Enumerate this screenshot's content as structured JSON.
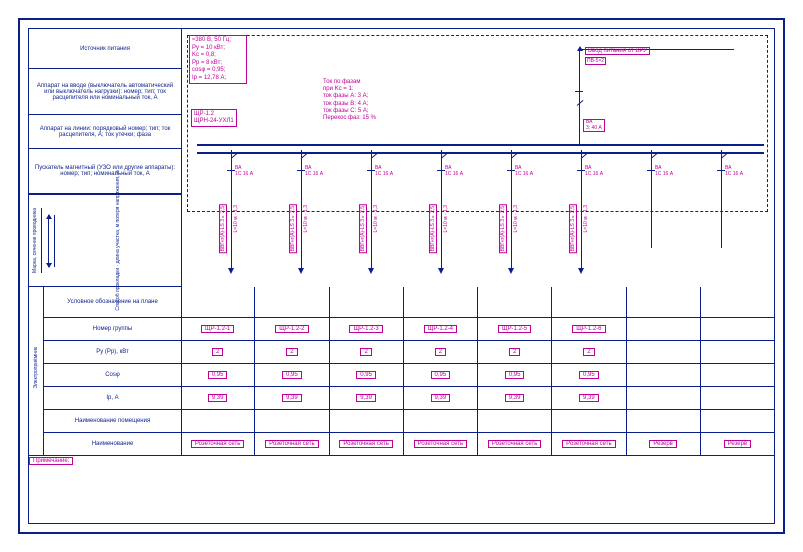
{
  "legend": {
    "row1": "Источник питания",
    "row2": "Аппарат на вводе\n(выключатель автоматический или выключатель нагрузки):\nномер; тип; ток расцепителя или номинальный ток, А",
    "row3": "Аппарат на линии:\nпорядковый номер; тип; ток расцепителя, А; ток утечки; фаза",
    "row4": "Пускатель магнитный\n(УЗО или другие аппараты):\nномер; тип; номинальный ток, А",
    "cable_side_a": "Марка, сечение проводника",
    "cable_side_b": "",
    "cable_side_c": "Способ прокладки · длина участка, м\nпотеря напряжения, %"
  },
  "lowerleft": {
    "side": "Электроприёмник",
    "rows": [
      "Условное обозначение\nна плане",
      "Номер группы",
      "Ру (Рр), кВт",
      "Cosφ",
      "Iр, А",
      "Наименование помещения",
      "Наименование"
    ]
  },
  "panel": {
    "name": "ЩР-1.2",
    "model": "ЩРН-24-УХЛ1"
  },
  "params": {
    "l1": "≈380 В, 50 Гц;",
    "l2": "Ру = 10 кВт;",
    "l3": "Kc = 0,8;",
    "l4": "Рр = 8 кВт;",
    "l5": "cosφ = 0,95;",
    "l6": "Iр = 12,78 А;"
  },
  "phases": {
    "l1": "Ток по фазам",
    "l2": "при Kc = 1:",
    "l3": "ток фазы A: 3 А;",
    "l4": "ток фазы B: 4 А;",
    "l5": "ток фазы C: 5 А;",
    "l6": "Перекос фаз: 15 %"
  },
  "input": {
    "from": "Ввод питания от ВРУ",
    "cable": "ПВ-5×2",
    "breaker_type": "ВА",
    "breaker_rating": "3; 40 А"
  },
  "feeders": [
    {
      "breaker": "ВА",
      "rating": "1С 16 А",
      "cable": "ВВГнг(А)-LS 3×2,5",
      "len": "L=10 м · 1,3",
      "group": "ЩР-1.2-1",
      "p": "2",
      "cos": "0,95",
      "i": "9,39",
      "dest": "Розеточная сеть"
    },
    {
      "breaker": "ВА",
      "rating": "1С 16 А",
      "cable": "ВВГнг(А)-LS 3×2,5",
      "len": "L=10 м · 1,3",
      "group": "ЩР-1.2-2",
      "p": "2",
      "cos": "0,95",
      "i": "9,39",
      "dest": "Розеточная сеть"
    },
    {
      "breaker": "ВА",
      "rating": "1С 16 А",
      "cable": "ВВГнг(А)-LS 3×2,5",
      "len": "L=10 м · 1,3",
      "group": "ЩР-1.2-3",
      "p": "2",
      "cos": "0,95",
      "i": "9,39",
      "dest": "Розеточная сеть"
    },
    {
      "breaker": "ВА",
      "rating": "1С 16 А",
      "cable": "ВВГнг(А)-LS 3×2,5",
      "len": "L=10 м · 1,3",
      "group": "ЩР-1.2-4",
      "p": "2",
      "cos": "0,95",
      "i": "9,39",
      "dest": "Розеточная сеть"
    },
    {
      "breaker": "ВА",
      "rating": "1С 16 А",
      "cable": "ВВГнг(А)-LS 3×2,5",
      "len": "L=10 м · 1,3",
      "group": "ЩР-1.2-5",
      "p": "2",
      "cos": "0,95",
      "i": "9,39",
      "dest": "Розеточная сеть"
    },
    {
      "breaker": "ВА",
      "rating": "1С 16 А",
      "cable": "ВВГнг(А)-LS 3×2,5",
      "len": "L=10 м · 1,3",
      "group": "ЩР-1.2-6",
      "p": "2",
      "cos": "0,95",
      "i": "9,39",
      "dest": "Розеточная сеть"
    },
    {
      "breaker": "ВА",
      "rating": "1С 16 А",
      "cable": "",
      "len": "",
      "group": "",
      "p": "",
      "cos": "",
      "i": "",
      "dest": "Резерв"
    },
    {
      "breaker": "ВА",
      "rating": "1С 16 А",
      "cable": "",
      "len": "",
      "group": "",
      "p": "",
      "cos": "",
      "i": "",
      "dest": "Резерв"
    }
  ],
  "foot": "Примечание:"
}
